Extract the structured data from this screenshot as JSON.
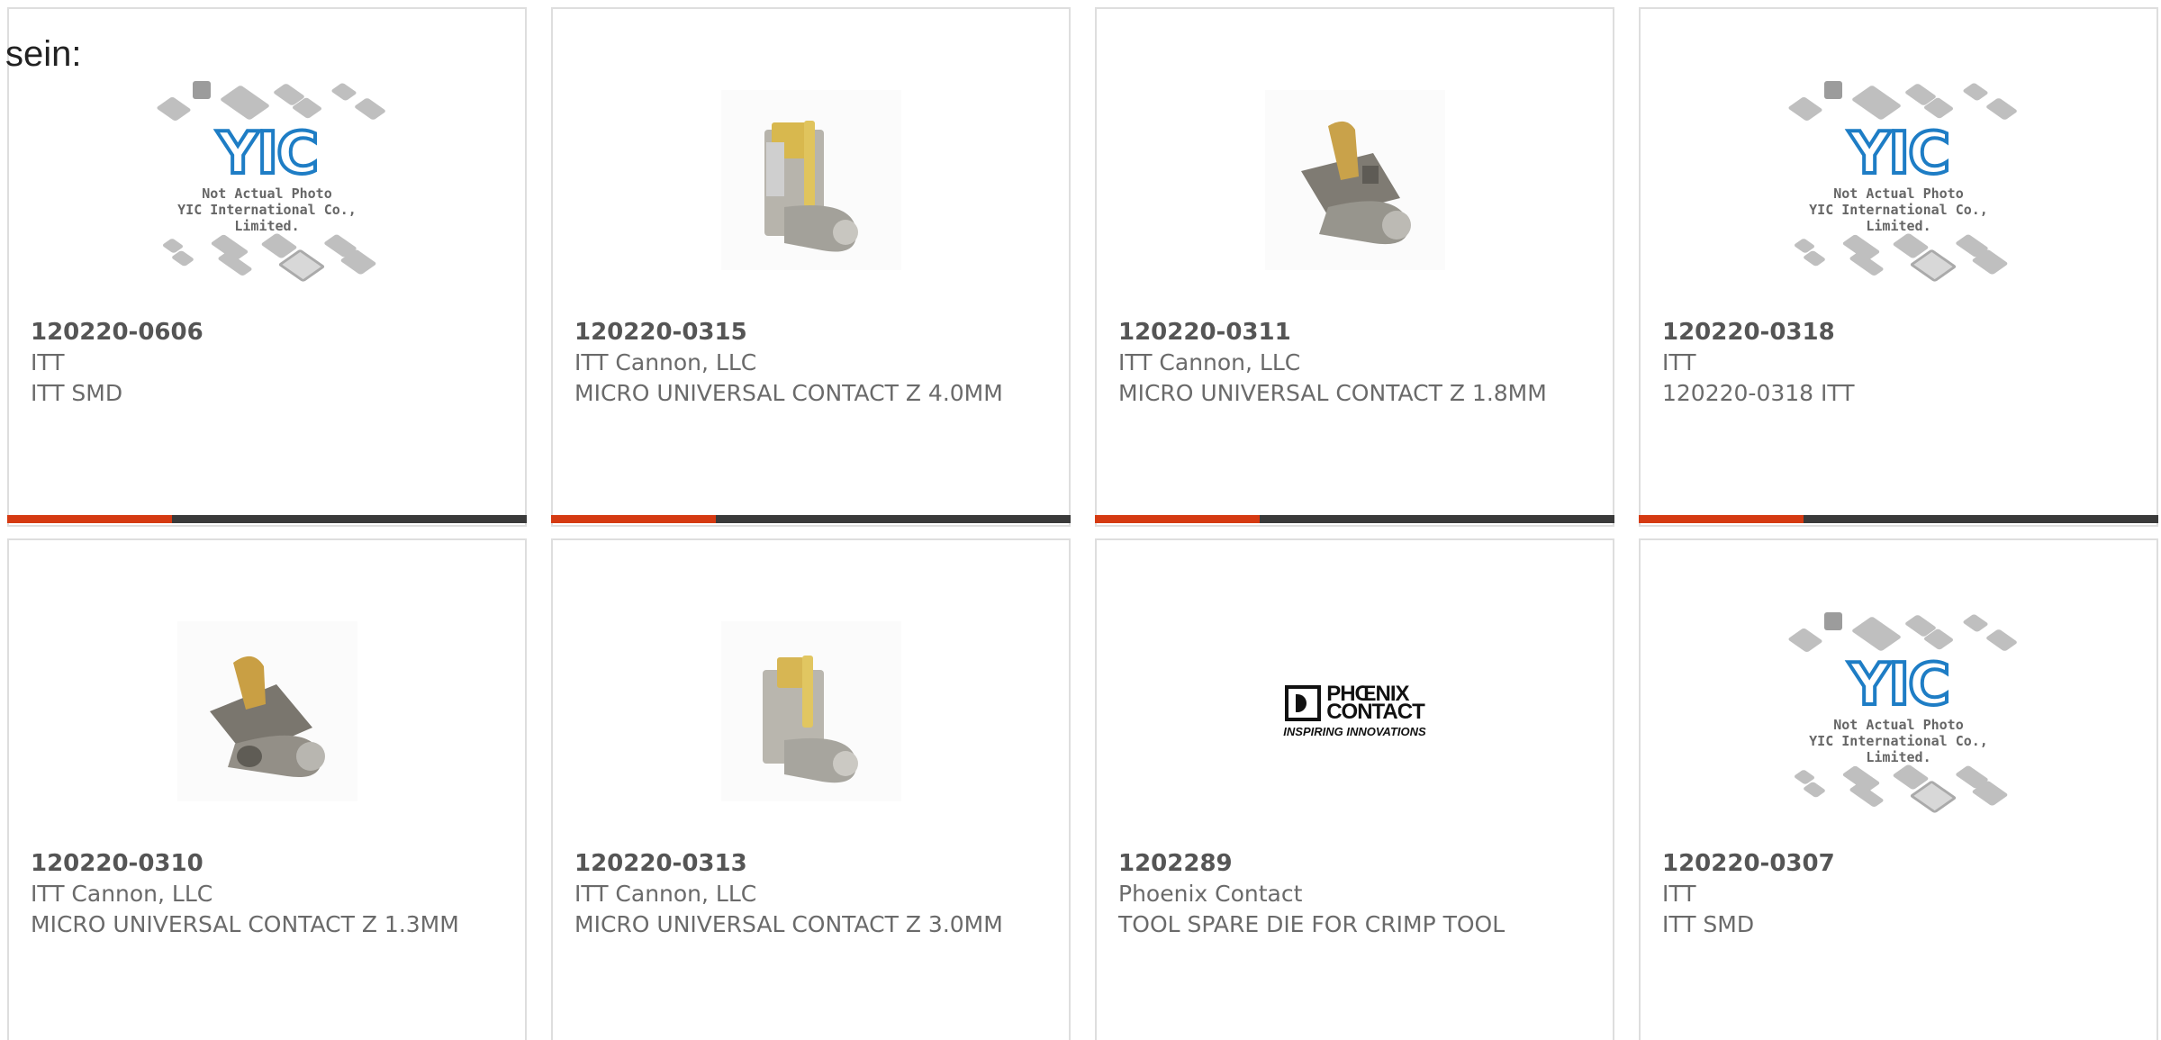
{
  "lead_text": "sein:",
  "image_caption": {
    "line1": "Not Actual Photo",
    "line2": "YIC International Co., Limited."
  },
  "brand_logos": {
    "yic": "YIC",
    "phoenix_line1": "PHŒNIX",
    "phoenix_line2": "CONTACT",
    "phoenix_tagline": "INSPIRING INNOVATIONS"
  },
  "colors": {
    "accent": "#d53a12",
    "bar": "#3a3a3a",
    "yic_blue": "#1e7dc5"
  },
  "products": [
    {
      "part_number": "120220-0606",
      "manufacturer": "ITT",
      "description": "ITT SMD",
      "image": "yic-placeholder-icon"
    },
    {
      "part_number": "120220-0315",
      "manufacturer": "ITT Cannon, LLC",
      "description": "MICRO UNIVERSAL CONTACT Z 4.0MM",
      "image": "contact-clip-photo-icon"
    },
    {
      "part_number": "120220-0311",
      "manufacturer": "ITT Cannon, LLC",
      "description": "MICRO UNIVERSAL CONTACT Z 1.8MM",
      "image": "contact-clip-photo-icon"
    },
    {
      "part_number": "120220-0318",
      "manufacturer": "ITT",
      "description": "120220-0318 ITT",
      "image": "yic-placeholder-icon"
    },
    {
      "part_number": "120220-0310",
      "manufacturer": "ITT Cannon, LLC",
      "description": "MICRO UNIVERSAL CONTACT Z 1.3MM",
      "image": "contact-clip-photo-icon"
    },
    {
      "part_number": "120220-0313",
      "manufacturer": "ITT Cannon, LLC",
      "description": "MICRO UNIVERSAL CONTACT Z 3.0MM",
      "image": "contact-clip-photo-icon"
    },
    {
      "part_number": "1202289",
      "manufacturer": "Phoenix Contact",
      "description": "TOOL SPARE DIE FOR CRIMP TOOL",
      "image": "phoenix-contact-logo-icon"
    },
    {
      "part_number": "120220-0307",
      "manufacturer": "ITT",
      "description": "ITT SMD",
      "image": "yic-placeholder-icon"
    }
  ]
}
